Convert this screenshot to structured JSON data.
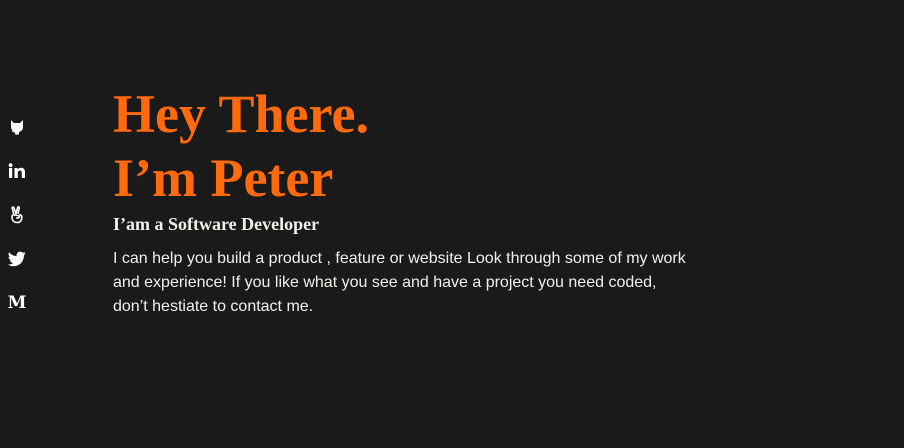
{
  "social": {
    "items": [
      {
        "icon": "github-icon",
        "label": "GitHub"
      },
      {
        "icon": "linkedin-icon",
        "label": "LinkedIn"
      },
      {
        "icon": "angellist-icon",
        "label": "AngelList"
      },
      {
        "icon": "twitter-icon",
        "label": "Twitter"
      },
      {
        "icon": "medium-icon",
        "label": "Medium",
        "glyph": "M"
      }
    ]
  },
  "hero": {
    "headline_line1": "Hey There.",
    "headline_line2": "I’m Peter",
    "subtitle": "I’am a Software Developer",
    "intro": "I can help you build a product , feature or website Look through some of my work and experience! If you like what you see and have a project you need coded, don’t hestiate to contact me."
  },
  "colors": {
    "background": "#1b1a1a",
    "accent": "#ff6a0d",
    "text": "#f3f0e9"
  }
}
